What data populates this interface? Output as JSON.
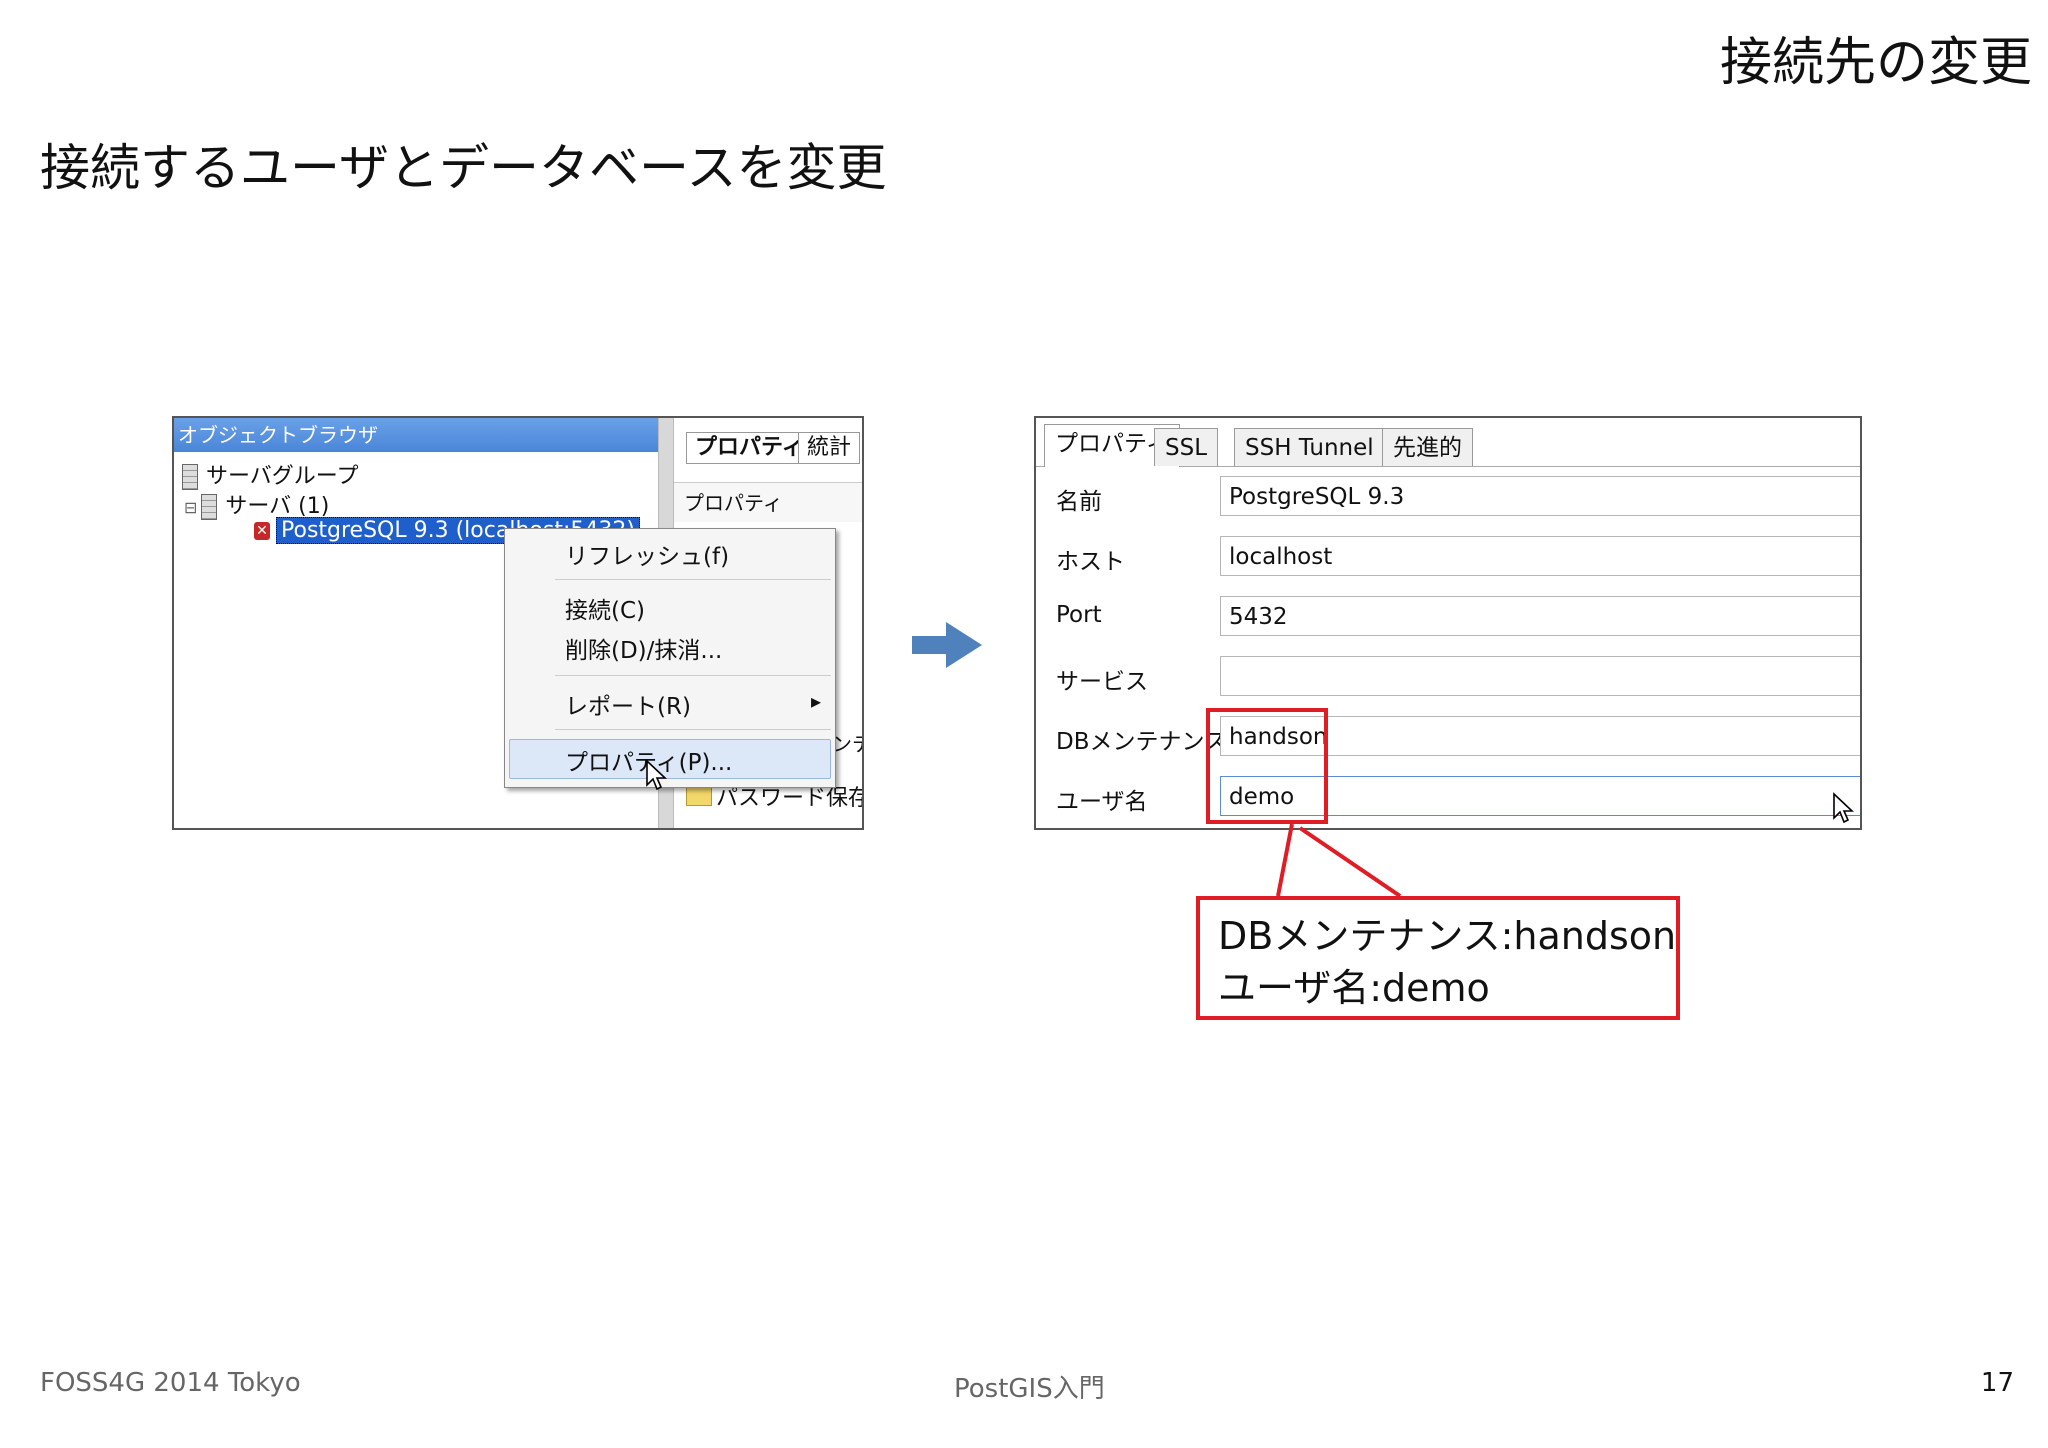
{
  "slide": {
    "title": "接続先の変更",
    "subtitle": "接続するユーザとデータベースを変更",
    "footer_left": "FOSS4G 2014 Tokyo",
    "footer_center": "PostGIS入門",
    "page_number": "17"
  },
  "object_browser": {
    "title": "オブジェクトブラウザ",
    "close": "×",
    "tree": {
      "group": "サーバグループ",
      "servers": "サーバ (1)",
      "server": "PostgreSQL 9.3 (localhost:5432)"
    },
    "right_tabs": [
      "プロパティ",
      "統計"
    ],
    "right_body_label": "プロパティ",
    "right_fragment": "ンテ",
    "password_row": "パスワード保存?"
  },
  "context_menu": {
    "items": [
      "リフレッシュ(f)",
      "接続(C)",
      "削除(D)/抹消...",
      "レポート(R)",
      "プロパティ(P)..."
    ],
    "submenu_arrow": "▸"
  },
  "properties_dialog": {
    "tabs": [
      "プロパティ",
      "SSL",
      "SSH Tunnel",
      "先進的"
    ],
    "fields": [
      {
        "label": "名前",
        "value": "PostgreSQL 9.3"
      },
      {
        "label": "ホスト",
        "value": "localhost"
      },
      {
        "label": "Port",
        "value": "5432"
      },
      {
        "label": "サービス",
        "value": ""
      },
      {
        "label": "DBメンテナンス",
        "value": "handson"
      },
      {
        "label": "ユーザ名",
        "value": "demo"
      }
    ]
  },
  "callout": {
    "line1": "DBメンテナンス:handson",
    "line2": "ユーザ名:demo"
  },
  "colors": {
    "accent_red": "#e01c24",
    "arrow_blue": "#4f81bd",
    "selection_blue": "#1f5fcc"
  }
}
